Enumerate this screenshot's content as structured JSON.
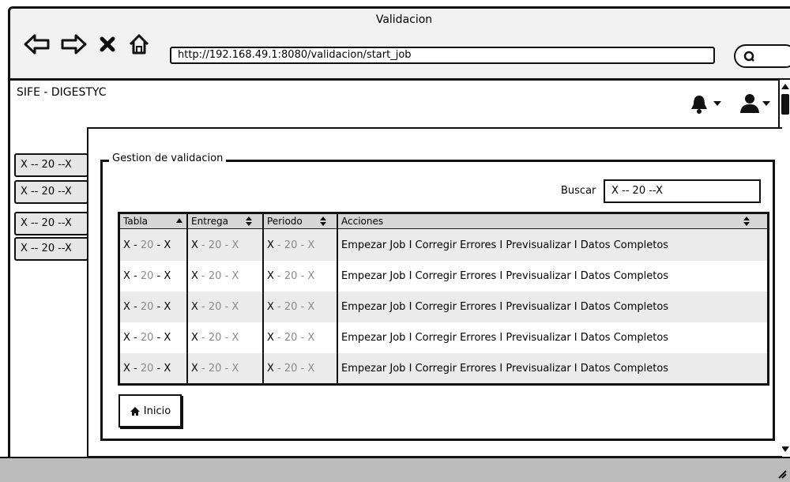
{
  "browser": {
    "window_title": "Validacion",
    "url": "http://192.168.49.1:8080/validacion/start_job",
    "icons": [
      "back-arrow-icon",
      "forward-arrow-icon",
      "stop-icon",
      "home-icon",
      "search-icon"
    ]
  },
  "app": {
    "title": "SIFE - DIGESTYC",
    "header_icons": [
      "bell-icon",
      "user-icon"
    ]
  },
  "sidebar": {
    "items": [
      {
        "label": "X -- 20 --X"
      },
      {
        "label": "X -- 20 --X"
      },
      {
        "label": "X -- 20 --X"
      },
      {
        "label": "X -- 20 --X"
      }
    ]
  },
  "panel": {
    "legend": "Gestion de validacion",
    "search_label": "Buscar",
    "search_value": "X -- 20 --X",
    "home_button_label": "Inicio"
  },
  "table": {
    "columns": [
      "Tabla",
      "Entrega",
      "Periodo",
      "Acciones"
    ],
    "rows": [
      {
        "tabla": [
          "X - ",
          "20",
          " - X"
        ],
        "entrega": [
          "X",
          " - 20 - X"
        ],
        "periodo": [
          "X",
          " - 20 - X"
        ],
        "acciones": "Empezar Job I Corregir Errores I Previsualizar I Datos Completos"
      },
      {
        "tabla": [
          "X - ",
          "20",
          " - X"
        ],
        "entrega": [
          "X",
          " - 20 - X"
        ],
        "periodo": [
          "X",
          " - 20 - X"
        ],
        "acciones": "Empezar Job I Corregir Errores I Previsualizar I Datos Completos"
      },
      {
        "tabla": [
          "X - ",
          "20",
          " - X"
        ],
        "entrega": [
          "X",
          " - 20 - X"
        ],
        "periodo": [
          "X",
          " - 20 - X"
        ],
        "acciones": "Empezar Job I Corregir Errores I Previsualizar I Datos Completos"
      },
      {
        "tabla": [
          "X - ",
          "20",
          " - X"
        ],
        "entrega": [
          "X",
          " - 20 - X"
        ],
        "periodo": [
          "X",
          " - 20 - X"
        ],
        "acciones": "Empezar Job I Corregir Errores I Previsualizar I Datos Completos"
      },
      {
        "tabla": [
          "X - ",
          "20",
          " - X"
        ],
        "entrega": [
          "X",
          " - 20 - X"
        ],
        "periodo": [
          "X",
          " - 20 - X"
        ],
        "acciones": "Empezar Job I Corregir Errores I Previsualizar I Datos Completos"
      }
    ]
  }
}
